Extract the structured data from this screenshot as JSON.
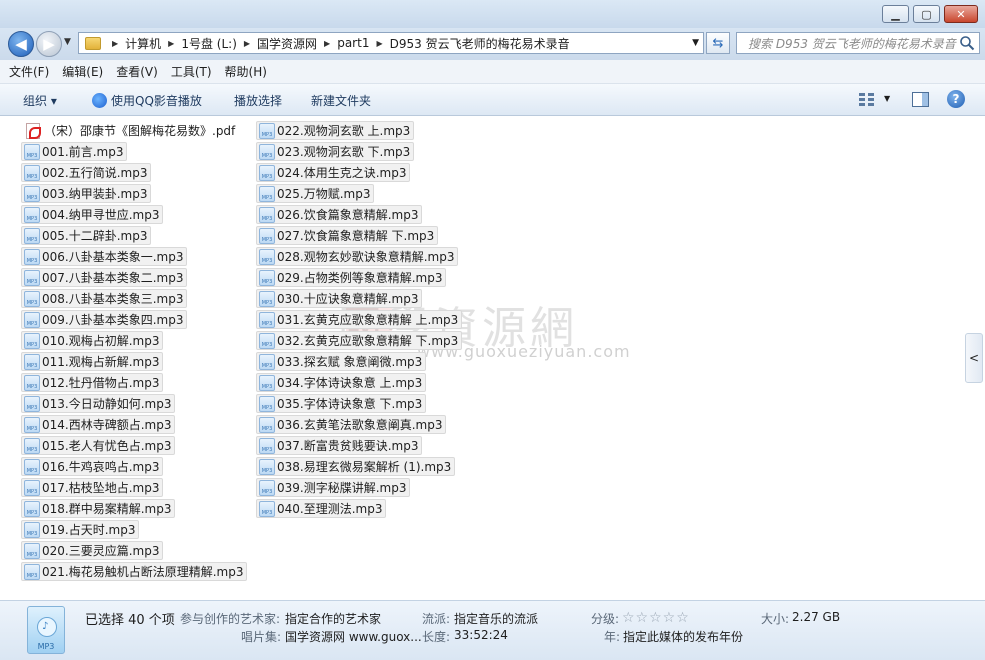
{
  "window": {
    "controls": {
      "minimize": "▁",
      "maximize": "▢",
      "close": "✕"
    }
  },
  "nav": {
    "back_glyph": "◀",
    "forward_glyph": "▶",
    "breadcrumbs": [
      "计算机",
      "1号盘 (L:)",
      "国学资源网",
      "part1",
      "D953 贺云飞老师的梅花易术录音"
    ],
    "search_placeholder": "搜索 D953 贺云飞老师的梅花易术录音"
  },
  "menu": [
    "文件(F)",
    "编辑(E)",
    "查看(V)",
    "工具(T)",
    "帮助(H)"
  ],
  "toolbar": {
    "organize": "组织 ▾",
    "play_qq": "使用QQ影音播放",
    "play_selection": "播放选择",
    "new_folder": "新建文件夹"
  },
  "watermark": {
    "text": "國學資源網",
    "url": "www.guoxueziyuan.com"
  },
  "files_col1": [
    "（宋）邵康节《图解梅花易数》.pdf",
    "001.前言.mp3",
    "002.五行简说.mp3",
    "003.纳甲装卦.mp3",
    "004.纳甲寻世应.mp3",
    "005.十二辟卦.mp3",
    "006.八卦基本类象一.mp3",
    "007.八卦基本类象二.mp3",
    "008.八卦基本类象三.mp3",
    "009.八卦基本类象四.mp3",
    "010.观梅占初解.mp3",
    "011.观梅占新解.mp3",
    "012.牡丹借物占.mp3",
    "013.今日动静如何.mp3",
    "014.西林寺碑额占.mp3",
    "015.老人有忧色占.mp3",
    "016.牛鸡哀鸣占.mp3",
    "017.枯枝坠地占.mp3",
    "018.群中易案精解.mp3",
    "019.占天时.mp3",
    "020.三要灵应篇.mp3",
    "021.梅花易触机占断法原理精解.mp3"
  ],
  "files_col2": [
    "022.观物洞玄歌 上.mp3",
    "023.观物洞玄歌 下.mp3",
    "024.体用生克之诀.mp3",
    "025.万物赋.mp3",
    "026.饮食篇象意精解.mp3",
    "027.饮食篇象意精解 下.mp3",
    "028.观物玄妙歌诀象意精解.mp3",
    "029.占物类例等象意精解.mp3",
    "030.十应诀象意精解.mp3",
    "031.玄黄克应歌象意精解 上.mp3",
    "032.玄黄克应歌象意精解 下.mp3",
    "033.探玄赋 象意阐微.mp3",
    "034.字体诗诀象意 上.mp3",
    "035.字体诗诀象意 下.mp3",
    "036.玄黄笔法歌象意阐真.mp3",
    "037.断富贵贫贱要诀.mp3",
    "038.易理玄微易案解析 (1).mp3",
    "039.测字秘牒讲解.mp3",
    "040.至理测法.mp3"
  ],
  "details": {
    "icon_label": "MP3",
    "selected": "已选择 40 个项",
    "artist_label": "参与创作的艺术家:",
    "artist_value": "指定合作的艺术家",
    "album_label": "唱片集:",
    "album_value": "国学资源网 www.guox...",
    "genre_label": "流派:",
    "genre_value": "指定音乐的流派",
    "length_label": "长度:",
    "length_value": "33:52:24",
    "rating_label": "分级:",
    "rating_stars": "☆☆☆☆☆",
    "year_label": "年:",
    "year_value": "指定此媒体的发布年份",
    "size_label": "大小:",
    "size_value": "2.27 GB"
  }
}
